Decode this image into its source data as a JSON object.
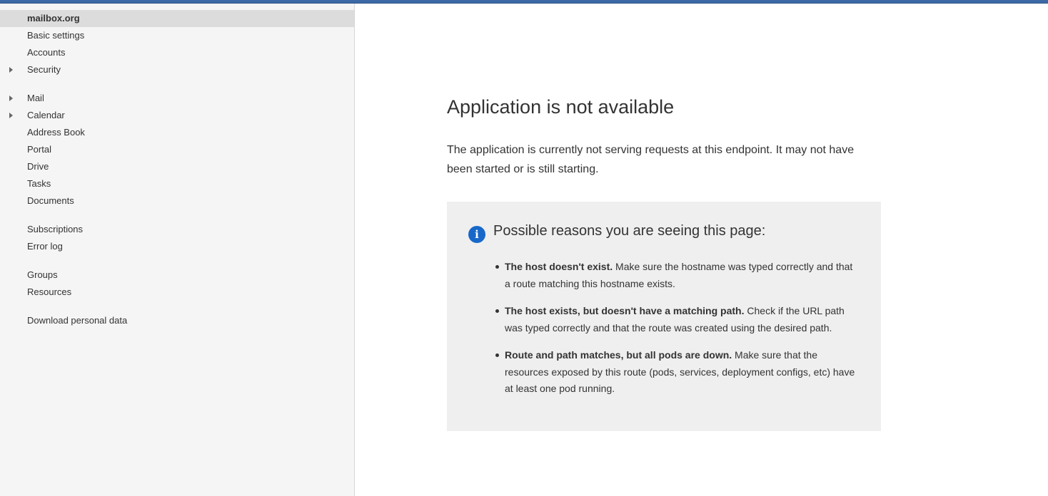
{
  "sidebar": {
    "items": [
      {
        "label": "mailbox.org",
        "selected": true,
        "expandable": false
      },
      {
        "label": "Basic settings",
        "expandable": false
      },
      {
        "label": "Accounts",
        "expandable": false
      },
      {
        "label": "Security",
        "expandable": true
      },
      {
        "label": "Mail",
        "expandable": true
      },
      {
        "label": "Calendar",
        "expandable": true
      },
      {
        "label": "Address Book",
        "expandable": false
      },
      {
        "label": "Portal",
        "expandable": false
      },
      {
        "label": "Drive",
        "expandable": false
      },
      {
        "label": "Tasks",
        "expandable": false
      },
      {
        "label": "Documents",
        "expandable": false
      },
      {
        "label": "Subscriptions",
        "expandable": false
      },
      {
        "label": "Error log",
        "expandable": false
      },
      {
        "label": "Groups",
        "expandable": false
      },
      {
        "label": "Resources",
        "expandable": false
      },
      {
        "label": "Download personal data",
        "expandable": false
      }
    ]
  },
  "main": {
    "title": "Application is not available",
    "lead": "The application is currently not serving requests at this endpoint. It may not have been started or is still starting.",
    "reasons": {
      "icon": "info-icon",
      "icon_glyph": "i",
      "heading": "Possible reasons you are seeing this page:",
      "items": [
        {
          "bold": "The host doesn't exist.",
          "text": " Make sure the hostname was typed correctly and that a route matching this hostname exists."
        },
        {
          "bold": "The host exists, but doesn't have a matching path.",
          "text": " Check if the URL path was typed correctly and that the route was created using the desired path."
        },
        {
          "bold": "Route and path matches, but all pods are down.",
          "text": " Make sure that the resources exposed by this route (pods, services, deployment configs, etc) have at least one pod running."
        }
      ]
    }
  },
  "colors": {
    "topbar": "#3d6aa5",
    "sidebar_bg": "#f5f5f5",
    "selected_bg": "#dcdcdc",
    "info_icon": "#1768c9",
    "reasons_bg": "#efefef",
    "text": "#333333"
  }
}
